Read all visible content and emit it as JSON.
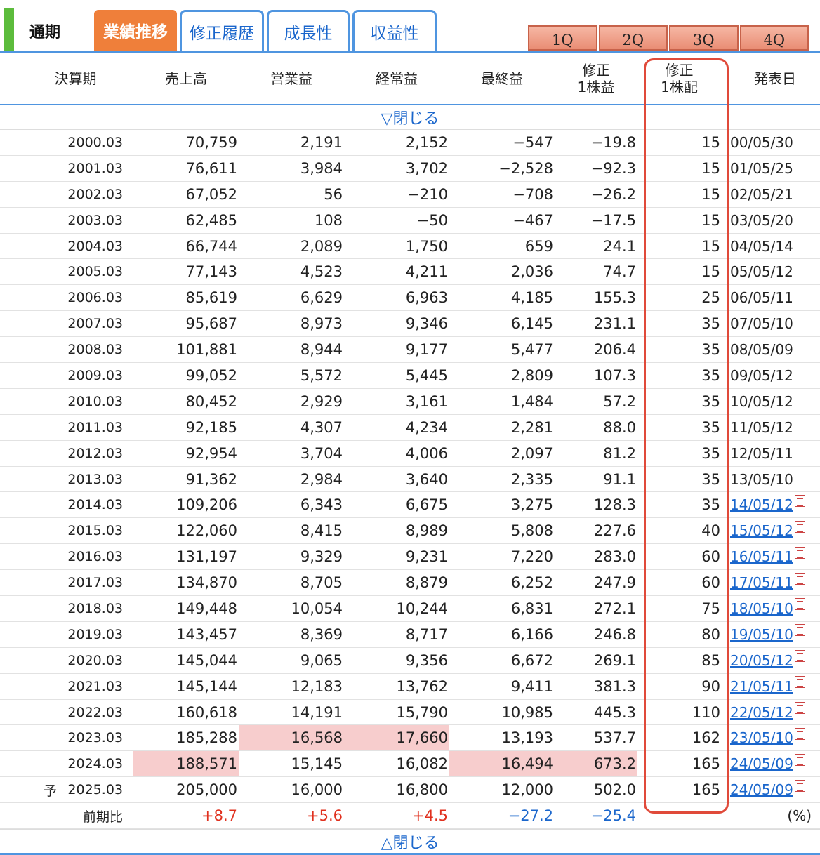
{
  "period_label": "通期",
  "tabs": [
    {
      "label": "業績推移",
      "active": true
    },
    {
      "label": "修正履歴",
      "active": false
    },
    {
      "label": "成長性",
      "active": false
    },
    {
      "label": "収益性",
      "active": false
    }
  ],
  "quarters": [
    "1Q",
    "2Q",
    "3Q",
    "4Q"
  ],
  "headers": {
    "period": "決算期",
    "sales": "売上高",
    "operating": "営業益",
    "ordinary": "経常益",
    "net": "最終益",
    "eps_top": "修正",
    "eps_bottom": "1株益",
    "div_top": "修正",
    "div_bottom": "1株配",
    "date": "発表日"
  },
  "toggle_top": "▽閉じる",
  "toggle_bottom": "△閉じる",
  "rows": [
    {
      "period": "2000.03",
      "sales": "70,759",
      "op": "2,191",
      "ord": "2,152",
      "net": "−547",
      "eps": "−19.8",
      "div": "15",
      "date": "00/05/30"
    },
    {
      "period": "2001.03",
      "sales": "76,611",
      "op": "3,984",
      "ord": "3,702",
      "net": "−2,528",
      "eps": "−92.3",
      "div": "15",
      "date": "01/05/25"
    },
    {
      "period": "2002.03",
      "sales": "67,052",
      "op": "56",
      "ord": "−210",
      "net": "−708",
      "eps": "−26.2",
      "div": "15",
      "date": "02/05/21"
    },
    {
      "period": "2003.03",
      "sales": "62,485",
      "op": "108",
      "ord": "−50",
      "net": "−467",
      "eps": "−17.5",
      "div": "15",
      "date": "03/05/20"
    },
    {
      "period": "2004.03",
      "sales": "66,744",
      "op": "2,089",
      "ord": "1,750",
      "net": "659",
      "eps": "24.1",
      "div": "15",
      "date": "04/05/14"
    },
    {
      "period": "2005.03",
      "sales": "77,143",
      "op": "4,523",
      "ord": "4,211",
      "net": "2,036",
      "eps": "74.7",
      "div": "15",
      "date": "05/05/12"
    },
    {
      "period": "2006.03",
      "sales": "85,619",
      "op": "6,629",
      "ord": "6,963",
      "net": "4,185",
      "eps": "155.3",
      "div": "25",
      "date": "06/05/11"
    },
    {
      "period": "2007.03",
      "sales": "95,687",
      "op": "8,973",
      "ord": "9,346",
      "net": "6,145",
      "eps": "231.1",
      "div": "35",
      "date": "07/05/10"
    },
    {
      "period": "2008.03",
      "sales": "101,881",
      "op": "8,944",
      "ord": "9,177",
      "net": "5,477",
      "eps": "206.4",
      "div": "35",
      "date": "08/05/09"
    },
    {
      "period": "2009.03",
      "sales": "99,052",
      "op": "5,572",
      "ord": "5,445",
      "net": "2,809",
      "eps": "107.3",
      "div": "35",
      "date": "09/05/12"
    },
    {
      "period": "2010.03",
      "sales": "80,452",
      "op": "2,929",
      "ord": "3,161",
      "net": "1,484",
      "eps": "57.2",
      "div": "35",
      "date": "10/05/12"
    },
    {
      "period": "2011.03",
      "sales": "92,185",
      "op": "4,307",
      "ord": "4,234",
      "net": "2,281",
      "eps": "88.0",
      "div": "35",
      "date": "11/05/12"
    },
    {
      "period": "2012.03",
      "sales": "92,954",
      "op": "3,704",
      "ord": "4,006",
      "net": "2,097",
      "eps": "81.2",
      "div": "35",
      "date": "12/05/11"
    },
    {
      "period": "2013.03",
      "sales": "91,362",
      "op": "2,984",
      "ord": "3,640",
      "net": "2,335",
      "eps": "91.1",
      "div": "35",
      "date": "13/05/10"
    },
    {
      "period": "2014.03",
      "sales": "109,206",
      "op": "6,343",
      "ord": "6,675",
      "net": "3,275",
      "eps": "128.3",
      "div": "35",
      "date": "14/05/12",
      "link": true
    },
    {
      "period": "2015.03",
      "sales": "122,060",
      "op": "8,415",
      "ord": "8,989",
      "net": "5,808",
      "eps": "227.6",
      "div": "40",
      "date": "15/05/12",
      "link": true
    },
    {
      "period": "2016.03",
      "sales": "131,197",
      "op": "9,329",
      "ord": "9,231",
      "net": "7,220",
      "eps": "283.0",
      "div": "60",
      "date": "16/05/11",
      "link": true
    },
    {
      "period": "2017.03",
      "sales": "134,870",
      "op": "8,705",
      "ord": "8,879",
      "net": "6,252",
      "eps": "247.9",
      "div": "60",
      "date": "17/05/11",
      "link": true
    },
    {
      "period": "2018.03",
      "sales": "149,448",
      "op": "10,054",
      "ord": "10,244",
      "net": "6,831",
      "eps": "272.1",
      "div": "75",
      "date": "18/05/10",
      "link": true
    },
    {
      "period": "2019.03",
      "sales": "143,457",
      "op": "8,369",
      "ord": "8,717",
      "net": "6,166",
      "eps": "246.8",
      "div": "80",
      "date": "19/05/10",
      "link": true
    },
    {
      "period": "2020.03",
      "sales": "145,044",
      "op": "9,065",
      "ord": "9,356",
      "net": "6,672",
      "eps": "269.1",
      "div": "85",
      "date": "20/05/12",
      "link": true
    },
    {
      "period": "2021.03",
      "sales": "145,144",
      "op": "12,183",
      "ord": "13,762",
      "net": "9,411",
      "eps": "381.3",
      "div": "90",
      "date": "21/05/11",
      "link": true
    },
    {
      "period": "2022.03",
      "sales": "160,618",
      "op": "14,191",
      "ord": "15,790",
      "net": "10,985",
      "eps": "445.3",
      "div": "110",
      "date": "22/05/12",
      "link": true
    },
    {
      "period": "2023.03",
      "sales": "185,288",
      "op": "16,568",
      "ord": "17,660",
      "net": "13,193",
      "eps": "537.7",
      "div": "162",
      "date": "23/05/10",
      "link": true,
      "hl": [
        "op",
        "ord"
      ]
    },
    {
      "period": "2024.03",
      "sales": "188,571",
      "op": "15,145",
      "ord": "16,082",
      "net": "16,494",
      "eps": "673.2",
      "div": "165",
      "date": "24/05/09",
      "link": true,
      "hl": [
        "sales",
        "net",
        "eps"
      ]
    },
    {
      "period": "2025.03",
      "forecast": "予",
      "sales": "205,000",
      "op": "16,000",
      "ord": "16,800",
      "net": "12,000",
      "eps": "502.0",
      "div": "165",
      "date": "24/05/09",
      "link": true
    }
  ],
  "change_row": {
    "label": "前期比",
    "sales": "+8.7",
    "op": "+5.6",
    "ord": "+4.5",
    "net": "−27.2",
    "eps": "−25.4",
    "unit": "(%)"
  },
  "colors": {
    "accent": "#ef7f3a",
    "tab_border": "#4f95e0",
    "link": "#1a66cc",
    "highlight": "#f7cdcd",
    "positive": "#e0301e",
    "negative": "#1a66cc",
    "annotation": "#e04a3a"
  },
  "icons": {
    "announcement_link": "pdf-icon"
  }
}
